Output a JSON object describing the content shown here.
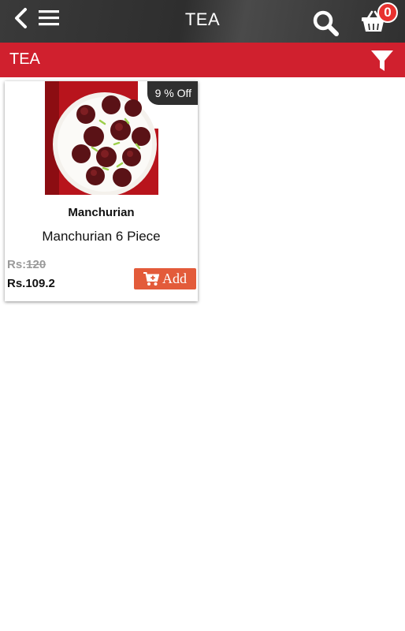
{
  "header": {
    "title": "TEA",
    "icons": [
      "back-icon",
      "menu-icon",
      "search-icon",
      "basket-icon"
    ],
    "cart_count": "0",
    "background": "#333333",
    "badge_color": "#e8312f"
  },
  "category_bar": {
    "title": "TEA",
    "icon": "filter-icon",
    "color": "#d0202e"
  },
  "products": [
    {
      "name": "Manchurian",
      "description": "Manchurian 6 Piece",
      "discount": "9 % Off",
      "old_price_prefix": "Rs:",
      "old_price": "120",
      "price": "Rs.109.2",
      "add_label": "Add",
      "add_icon": "cart-plus-icon",
      "add_color": "#e35b3a"
    }
  ]
}
